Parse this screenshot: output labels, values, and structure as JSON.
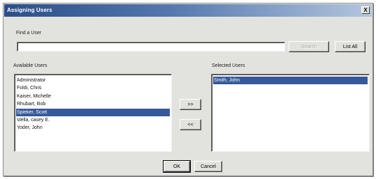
{
  "window": {
    "title": "Assigning Users",
    "close_glyph": "X"
  },
  "find": {
    "label": "Find a User",
    "value": "",
    "search_label": "Search",
    "list_all_label": "List All"
  },
  "available": {
    "label": "Available Users",
    "items": [
      {
        "name": "Administrator",
        "selected": false
      },
      {
        "name": "Foldi, Chris",
        "selected": false
      },
      {
        "name": "Kaiser, Michelle",
        "selected": false
      },
      {
        "name": "Rhubart, Bob",
        "selected": false
      },
      {
        "name": "Spieker, Scott",
        "selected": true
      },
      {
        "name": "stella, casey E.",
        "selected": false
      },
      {
        "name": "Yoder, John",
        "selected": false
      }
    ]
  },
  "transfer": {
    "add_label": ">>",
    "remove_label": "<<"
  },
  "selected_users": {
    "label": "Selected Users",
    "items": [
      {
        "name": "Smith, John",
        "selected": true
      }
    ]
  },
  "footer": {
    "ok_label": "OK",
    "cancel_label": "Cancel"
  },
  "colors": {
    "title_bar_start": "#2c4e88",
    "selection": "#36599a",
    "dialog_face": "#e2e2de"
  }
}
